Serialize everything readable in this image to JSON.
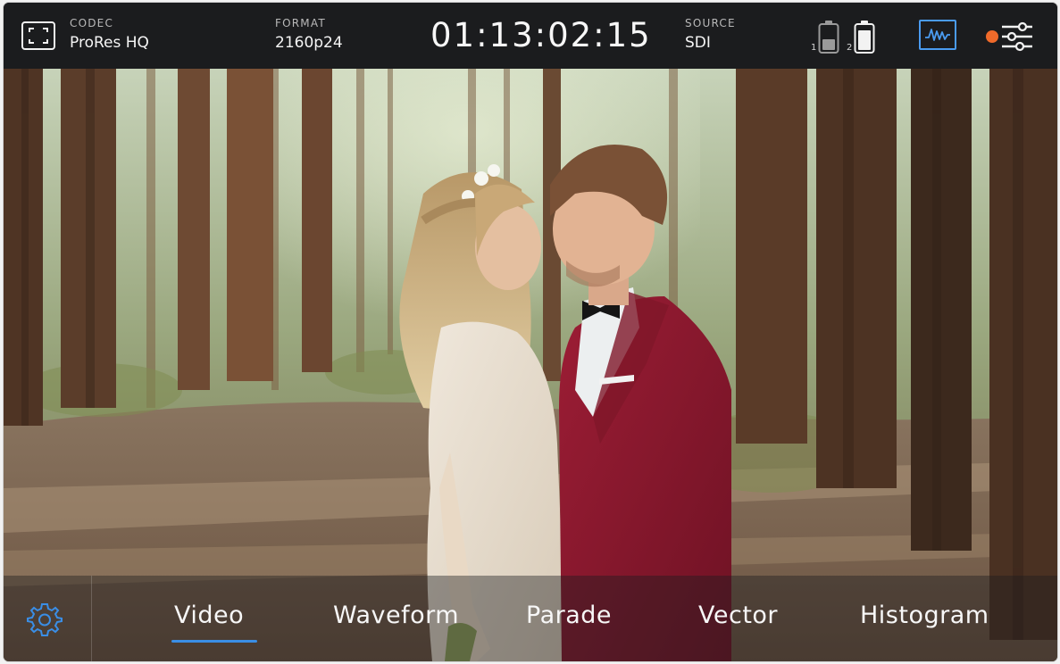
{
  "topbar": {
    "codec": {
      "label": "CODEC",
      "value": "ProRes HQ"
    },
    "format": {
      "label": "FORMAT",
      "value": "2160p24"
    },
    "timecode": "01:13:02:15",
    "source": {
      "label": "SOURCE",
      "value": "SDI"
    },
    "batteries": [
      {
        "number": "1",
        "level": 0.45
      },
      {
        "number": "2",
        "level": 0.85
      }
    ],
    "icons": {
      "frame_guide": "frame-guide-icon",
      "scope": "waveform-scope-icon",
      "settings": "sliders-icon"
    },
    "recording_indicator_color": "#f06a2a"
  },
  "bottom_menu": {
    "tabs": [
      {
        "label": "Video",
        "active": true
      },
      {
        "label": "Waveform",
        "active": false
      },
      {
        "label": "Parade",
        "active": false
      },
      {
        "label": "Vector",
        "active": false
      },
      {
        "label": "Histogram",
        "active": false
      }
    ],
    "settings_icon": "gear-icon"
  },
  "colors": {
    "accent": "#3a8ee6",
    "scope_icon": "#4a9bf0",
    "bar_bg": "#1b1c1e"
  }
}
